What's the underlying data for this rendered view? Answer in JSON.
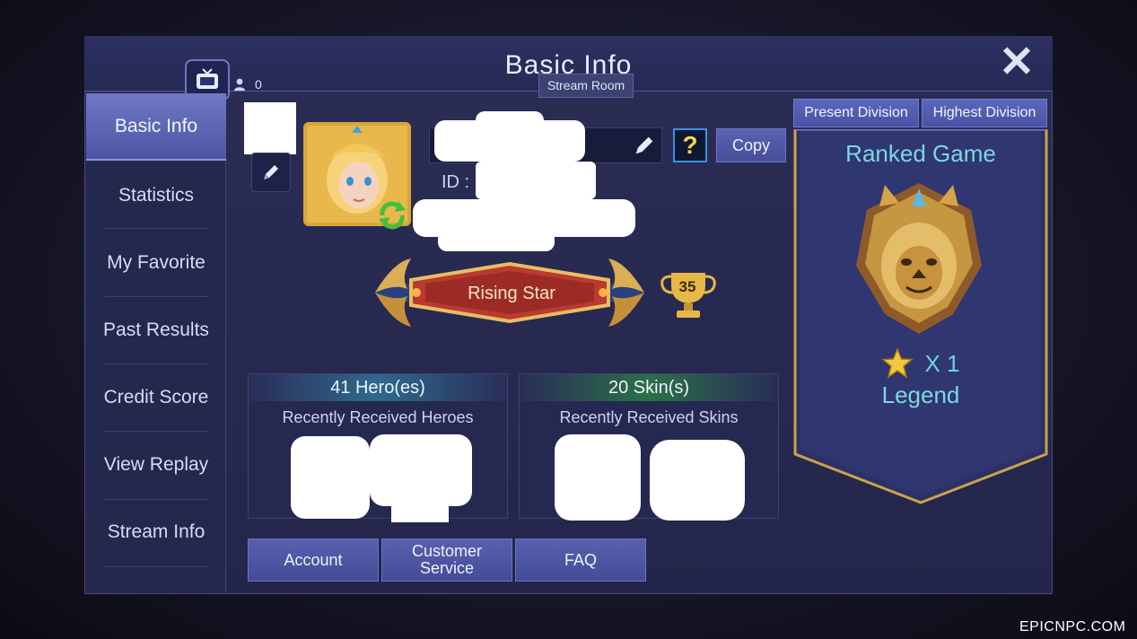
{
  "window": {
    "title": "Basic Info",
    "close_icon": "close-icon"
  },
  "stream": {
    "viewer_count": "0",
    "tooltip": "Stream Room"
  },
  "sidebar": {
    "items": [
      {
        "label": "Basic Info",
        "active": true
      },
      {
        "label": "Statistics"
      },
      {
        "label": "My Favorite"
      },
      {
        "label": "Past Results"
      },
      {
        "label": "Credit Score"
      },
      {
        "label": "View Replay"
      },
      {
        "label": "Stream Info"
      }
    ]
  },
  "profile": {
    "id_label": "ID :",
    "copy_label": "Copy",
    "help_label": "?"
  },
  "banner": {
    "title": "Rising Star",
    "trophy_count": "35"
  },
  "heroes": {
    "count_label": "41 Hero(es)",
    "subtitle": "Recently Received Heroes"
  },
  "skins": {
    "count_label": "20 Skin(s)",
    "subtitle": "Recently Received Skins"
  },
  "buttons": {
    "account": "Account",
    "customer_service": "Customer Service",
    "faq": "FAQ"
  },
  "division": {
    "tabs": [
      "Present Division",
      "Highest Division"
    ],
    "mode": "Ranked Game",
    "stars": "X  1",
    "rank": "Legend"
  },
  "watermark": "EPICNPC.COM",
  "colors": {
    "accent_cyan": "#7ed6e0",
    "button_blue": "#4e56a4",
    "gold": "#d7a63a"
  }
}
